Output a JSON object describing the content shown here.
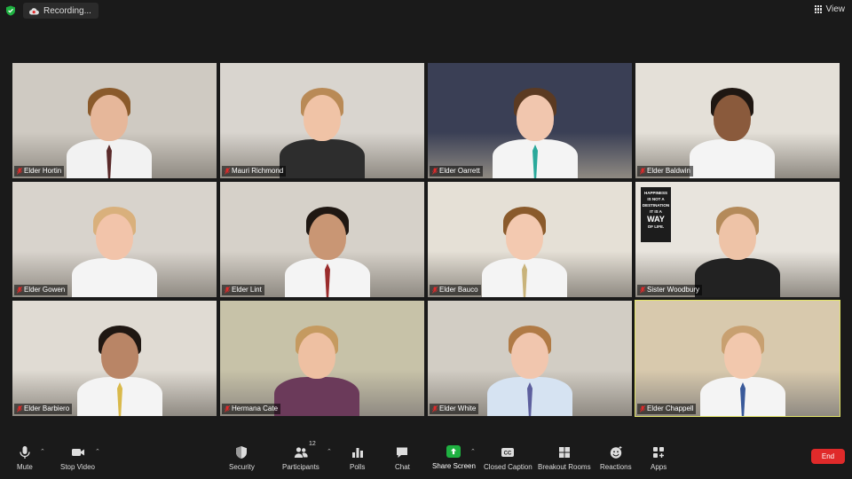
{
  "header": {
    "recording_label": "Recording...",
    "view_label": "View"
  },
  "participants": [
    {
      "name": "Elder Hortin",
      "bg": "#cfcac2",
      "skin": "#e6b79a",
      "hair": "#8a5a2b",
      "shirt": "#f2f2f2",
      "tie": "#5a2a2a"
    },
    {
      "name": "Mauri Richmond",
      "bg": "#d9d5cf",
      "skin": "#f0c3a6",
      "hair": "#b98a56",
      "shirt": "#2d2d2d",
      "tie": ""
    },
    {
      "name": "Elder Oarrett",
      "bg": "#3a3f55",
      "skin": "#f1c6ae",
      "hair": "#5b3a22",
      "shirt": "#f4f4f4",
      "tie": "#2aa99b"
    },
    {
      "name": "Elder Baldwin",
      "bg": "#e4e0d8",
      "skin": "#8a5a3c",
      "hair": "#1f1712",
      "shirt": "#f4f4f4",
      "tie": ""
    },
    {
      "name": "Elder Gowen",
      "bg": "#d8d3cc",
      "skin": "#f2c4aa",
      "hair": "#d9b07c",
      "shirt": "#f4f4f4",
      "tie": ""
    },
    {
      "name": "Elder Lint",
      "bg": "#d6d1c9",
      "skin": "#c99674",
      "hair": "#1f1712",
      "shirt": "#f4f4f4",
      "tie": "#9a2c2c"
    },
    {
      "name": "Elder Bauco",
      "bg": "#e5e0d6",
      "skin": "#f3c9b0",
      "hair": "#8a5a2b",
      "shirt": "#f4f4f4",
      "tie": "#c9b37a"
    },
    {
      "name": "Sister Woodbury",
      "bg": "#e8e4dd",
      "skin": "#eec3a7",
      "hair": "#b48a5a",
      "shirt": "#222222",
      "tie": ""
    },
    {
      "name": "Elder Barbiero",
      "bg": "#e0dbd3",
      "skin": "#b98566",
      "hair": "#1f1712",
      "shirt": "#f4f4f4",
      "tie": "#d9b94a"
    },
    {
      "name": "Hermana Cate",
      "bg": "#c7c2a8",
      "skin": "#eec0a2",
      "hair": "#c59a60",
      "shirt": "#6b3a5a",
      "tie": ""
    },
    {
      "name": "Elder White",
      "bg": "#d2cdc4",
      "skin": "#f1c6ae",
      "hair": "#b07a45",
      "shirt": "#d6e3f2",
      "tie": "#5d5f9e"
    },
    {
      "name": "Elder Chappell",
      "bg": "#d8c9ad",
      "skin": "#f2c8ad",
      "hair": "#c8a070",
      "shirt": "#f4f4f4",
      "tie": "#3a5a9a"
    }
  ],
  "active_participant": "Elder Chappell",
  "poster_text": [
    "HAPPINESS",
    "IS NOT A",
    "DESTINATION",
    "IT IS A",
    "WAY",
    "OF LIFE."
  ],
  "toolbar": {
    "mute_label": "Mute",
    "stop_video_label": "Stop Video",
    "security_label": "Security",
    "participants_label": "Participants",
    "participants_count": "12",
    "polls_label": "Polls",
    "chat_label": "Chat",
    "share_screen_label": "Share Screen",
    "closed_caption_label": "Closed Caption",
    "breakout_rooms_label": "Breakout Rooms",
    "reactions_label": "Reactions",
    "apps_label": "Apps",
    "end_label": "End"
  },
  "colors": {
    "share_green": "#1fb141",
    "end_red": "#e02a2a",
    "active_outline": "#e3e56a",
    "app_bg": "#1a1a1a"
  }
}
